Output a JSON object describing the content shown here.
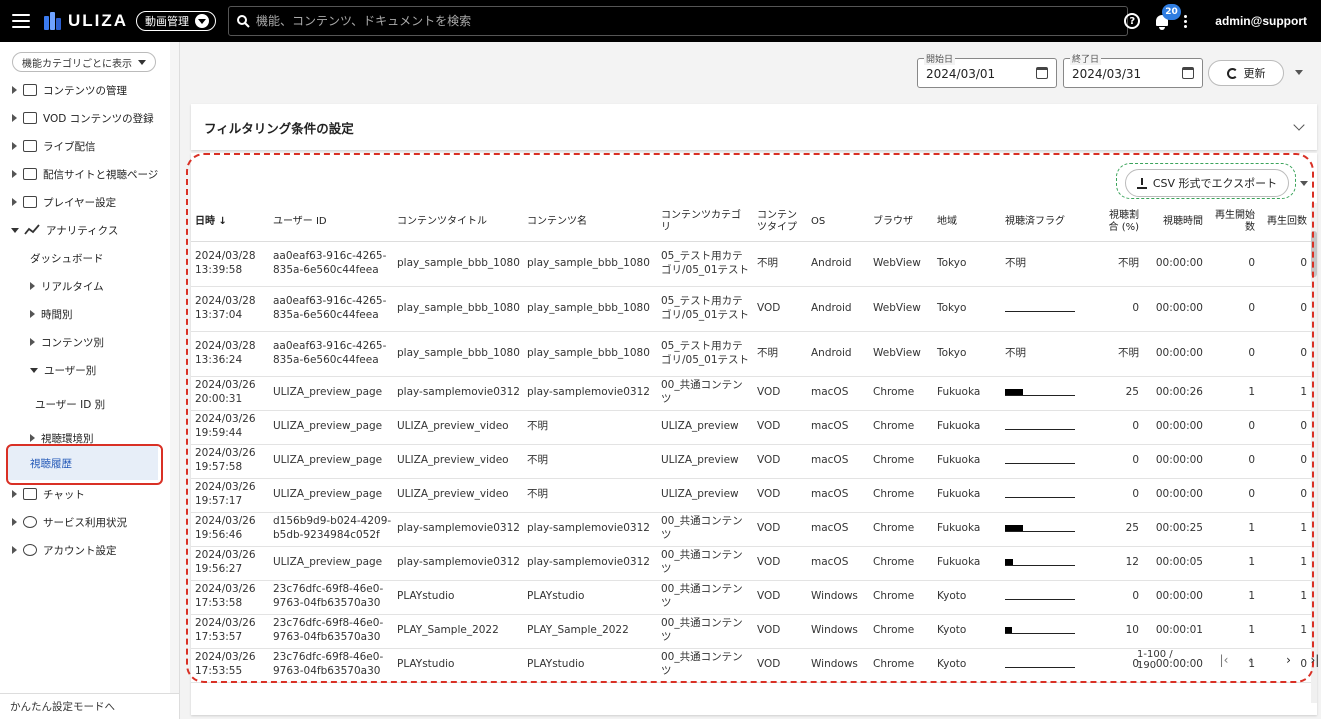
{
  "header": {
    "logo_text": "ULIZA",
    "module": "動画管理",
    "search_placeholder": "機能、コンテンツ、ドキュメントを検索",
    "notification_count": "20",
    "user": "admin@support"
  },
  "sidebar": {
    "category_select": "機能カテゴリごとに表示",
    "items": [
      {
        "label": "コンテンツの管理"
      },
      {
        "label": "VOD コンテンツの登録"
      },
      {
        "label": "ライブ配信"
      },
      {
        "label": "配信サイトと視聴ページ"
      },
      {
        "label": "プレイヤー設定"
      },
      {
        "label": "アナリティクス"
      },
      {
        "label": "ダッシュボード"
      },
      {
        "label": "リアルタイム"
      },
      {
        "label": "時間別"
      },
      {
        "label": "コンテンツ別"
      },
      {
        "label": "ユーザー別"
      },
      {
        "label": "ユーザー ID 別"
      },
      {
        "label": "視聴環境別"
      },
      {
        "label": "視聴履歴"
      },
      {
        "label": "チャット"
      },
      {
        "label": "サービス利用状況"
      },
      {
        "label": "アカウント設定"
      }
    ],
    "bottom_link": "かんたん設定モードへ"
  },
  "toolbar": {
    "start_label": "開始日",
    "start_value": "2024/03/01",
    "end_label": "終了日",
    "end_value": "2024/03/31",
    "refresh_label": "更新"
  },
  "filter": {
    "title": "フィルタリング条件の設定"
  },
  "table": {
    "export_label": "CSV 形式でエクスポート",
    "columns": [
      "日時",
      "ユーザー ID",
      "コンテンツタイトル",
      "コンテンツ名",
      "コンテンツカテゴリ",
      "コンテンツタイプ",
      "OS",
      "ブラウザ",
      "地域",
      "視聴済フラグ",
      "視聴割合 (%)",
      "視聴時間",
      "再生開始数",
      "再生回数"
    ],
    "rows": [
      {
        "date": "2024/03/28",
        "time": "13:39:58",
        "uid1": "aa0eaf63-916c-4265-",
        "uid2": "835a-6e560c44feea",
        "title": "play_sample_bbb_1080",
        "name": "play_sample_bbb_1080",
        "cat": "05_テスト用カテゴリ/05_01テスト",
        "type": "不明",
        "os": "Android",
        "browser": "WebView",
        "region": "Tokyo",
        "flag_text": "不明",
        "flag": 0,
        "ratio": "不明",
        "dur": "00:00:00",
        "starts": "0",
        "plays": "0"
      },
      {
        "date": "2024/03/28",
        "time": "13:37:04",
        "uid1": "aa0eaf63-916c-4265-",
        "uid2": "835a-6e560c44feea",
        "title": "play_sample_bbb_1080",
        "name": "play_sample_bbb_1080",
        "cat": "05_テスト用カテゴリ/05_01テスト",
        "type": "VOD",
        "os": "Android",
        "browser": "WebView",
        "region": "Tokyo",
        "flag_text": "",
        "flag": 0,
        "ratio": "0",
        "dur": "00:00:00",
        "starts": "0",
        "plays": "0"
      },
      {
        "date": "2024/03/28",
        "time": "13:36:24",
        "uid1": "aa0eaf63-916c-4265-",
        "uid2": "835a-6e560c44feea",
        "title": "play_sample_bbb_1080",
        "name": "play_sample_bbb_1080",
        "cat": "05_テスト用カテゴリ/05_01テスト",
        "type": "不明",
        "os": "Android",
        "browser": "WebView",
        "region": "Tokyo",
        "flag_text": "不明",
        "flag": 0,
        "ratio": "不明",
        "dur": "00:00:00",
        "starts": "0",
        "plays": "0"
      },
      {
        "date": "2024/03/26",
        "time": "20:00:31",
        "uid1": "ULIZA_preview_page",
        "uid2": "",
        "title": "play-samplemovie0312",
        "name": "play-samplemovie0312",
        "cat": "00_共通コンテンツ",
        "type": "VOD",
        "os": "macOS",
        "browser": "Chrome",
        "region": "Fukuoka",
        "flag_text": "",
        "flag": 25,
        "ratio": "25",
        "dur": "00:00:26",
        "starts": "1",
        "plays": "1"
      },
      {
        "date": "2024/03/26",
        "time": "19:59:44",
        "uid1": "ULIZA_preview_page",
        "uid2": "",
        "title": "ULIZA_preview_video",
        "name": "不明",
        "cat": "ULIZA_preview",
        "type": "VOD",
        "os": "macOS",
        "browser": "Chrome",
        "region": "Fukuoka",
        "flag_text": "",
        "flag": 0,
        "ratio": "0",
        "dur": "00:00:00",
        "starts": "0",
        "plays": "0"
      },
      {
        "date": "2024/03/26",
        "time": "19:57:58",
        "uid1": "ULIZA_preview_page",
        "uid2": "",
        "title": "ULIZA_preview_video",
        "name": "不明",
        "cat": "ULIZA_preview",
        "type": "VOD",
        "os": "macOS",
        "browser": "Chrome",
        "region": "Fukuoka",
        "flag_text": "",
        "flag": 0,
        "ratio": "0",
        "dur": "00:00:00",
        "starts": "0",
        "plays": "0"
      },
      {
        "date": "2024/03/26",
        "time": "19:57:17",
        "uid1": "ULIZA_preview_page",
        "uid2": "",
        "title": "ULIZA_preview_video",
        "name": "不明",
        "cat": "ULIZA_preview",
        "type": "VOD",
        "os": "macOS",
        "browser": "Chrome",
        "region": "Fukuoka",
        "flag_text": "",
        "flag": 0,
        "ratio": "0",
        "dur": "00:00:00",
        "starts": "0",
        "plays": "0"
      },
      {
        "date": "2024/03/26",
        "time": "19:56:46",
        "uid1": "d156b9d9-b024-4209-",
        "uid2": "b5db-9234984c052f",
        "title": "play-samplemovie0312",
        "name": "play-samplemovie0312",
        "cat": "00_共通コンテンツ",
        "type": "VOD",
        "os": "macOS",
        "browser": "Chrome",
        "region": "Fukuoka",
        "flag_text": "",
        "flag": 25,
        "ratio": "25",
        "dur": "00:00:25",
        "starts": "1",
        "plays": "1"
      },
      {
        "date": "2024/03/26",
        "time": "19:56:27",
        "uid1": "ULIZA_preview_page",
        "uid2": "",
        "title": "play-samplemovie0312",
        "name": "play-samplemovie0312",
        "cat": "00_共通コンテンツ",
        "type": "VOD",
        "os": "macOS",
        "browser": "Chrome",
        "region": "Fukuoka",
        "flag_text": "",
        "flag": 12,
        "ratio": "12",
        "dur": "00:00:05",
        "starts": "1",
        "plays": "1"
      },
      {
        "date": "2024/03/26",
        "time": "17:53:58",
        "uid1": "23c76dfc-69f8-46e0-",
        "uid2": "9763-04fb63570a30",
        "title": "PLAYstudio",
        "name": "PLAYstudio",
        "cat": "00_共通コンテンツ",
        "type": "VOD",
        "os": "Windows",
        "browser": "Chrome",
        "region": "Kyoto",
        "flag_text": "",
        "flag": 0,
        "ratio": "0",
        "dur": "00:00:00",
        "starts": "1",
        "plays": "1"
      },
      {
        "date": "2024/03/26",
        "time": "17:53:57",
        "uid1": "23c76dfc-69f8-46e0-",
        "uid2": "9763-04fb63570a30",
        "title": "PLAY_Sample_2022",
        "name": "PLAY_Sample_2022",
        "cat": "00_共通コンテンツ",
        "type": "VOD",
        "os": "Windows",
        "browser": "Chrome",
        "region": "Kyoto",
        "flag_text": "",
        "flag": 10,
        "ratio": "10",
        "dur": "00:00:01",
        "starts": "1",
        "plays": "1"
      },
      {
        "date": "2024/03/26",
        "time": "17:53:55",
        "uid1": "23c76dfc-69f8-46e0-",
        "uid2": "9763-04fb63570a30",
        "title": "PLAYstudio",
        "name": "PLAYstudio",
        "cat": "00_共通コンテンツ",
        "type": "VOD",
        "os": "Windows",
        "browser": "Chrome",
        "region": "Kyoto",
        "flag_text": "",
        "flag": 0,
        "ratio": "0",
        "dur": "00:00:00",
        "starts": "1",
        "plays": "0"
      }
    ]
  },
  "pagination": {
    "range": "1-100 / 190"
  }
}
